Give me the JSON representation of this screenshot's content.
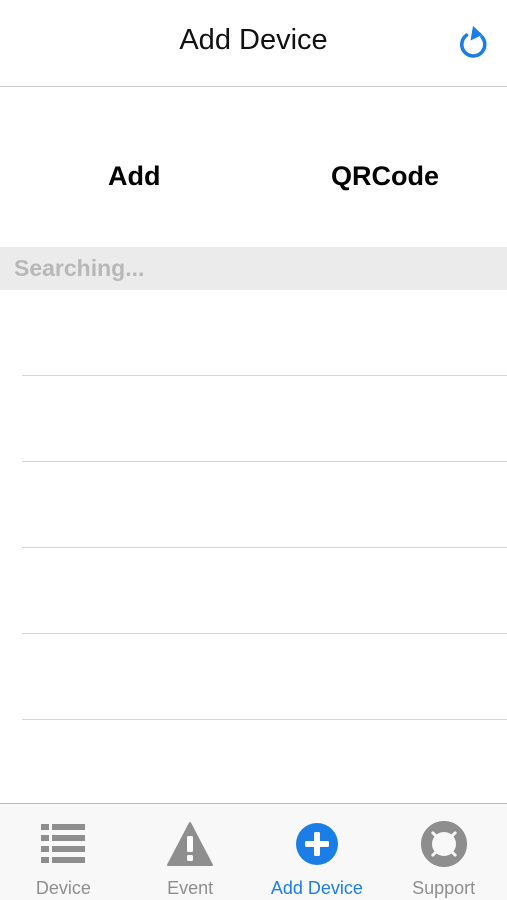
{
  "header": {
    "title": "Add Device",
    "refresh_icon": "refresh-icon"
  },
  "actions": {
    "add_label": "Add",
    "qrcode_label": "QRCode"
  },
  "status": {
    "text": "Searching..."
  },
  "list": {
    "rows": [
      "",
      "",
      "",
      "",
      "",
      ""
    ]
  },
  "tabbar": {
    "tabs": [
      {
        "label": "Device",
        "icon": "list-icon",
        "active": false
      },
      {
        "label": "Event",
        "icon": "warning-icon",
        "active": false
      },
      {
        "label": "Add Device",
        "icon": "plus-circle-icon",
        "active": true
      },
      {
        "label": "Support",
        "icon": "lifebuoy-icon",
        "active": false
      }
    ]
  },
  "colors": {
    "accent": "#1a7ee6",
    "inactive": "#8e8e8e",
    "status_bg": "#ebebeb",
    "status_text": "#b8b8b8"
  }
}
